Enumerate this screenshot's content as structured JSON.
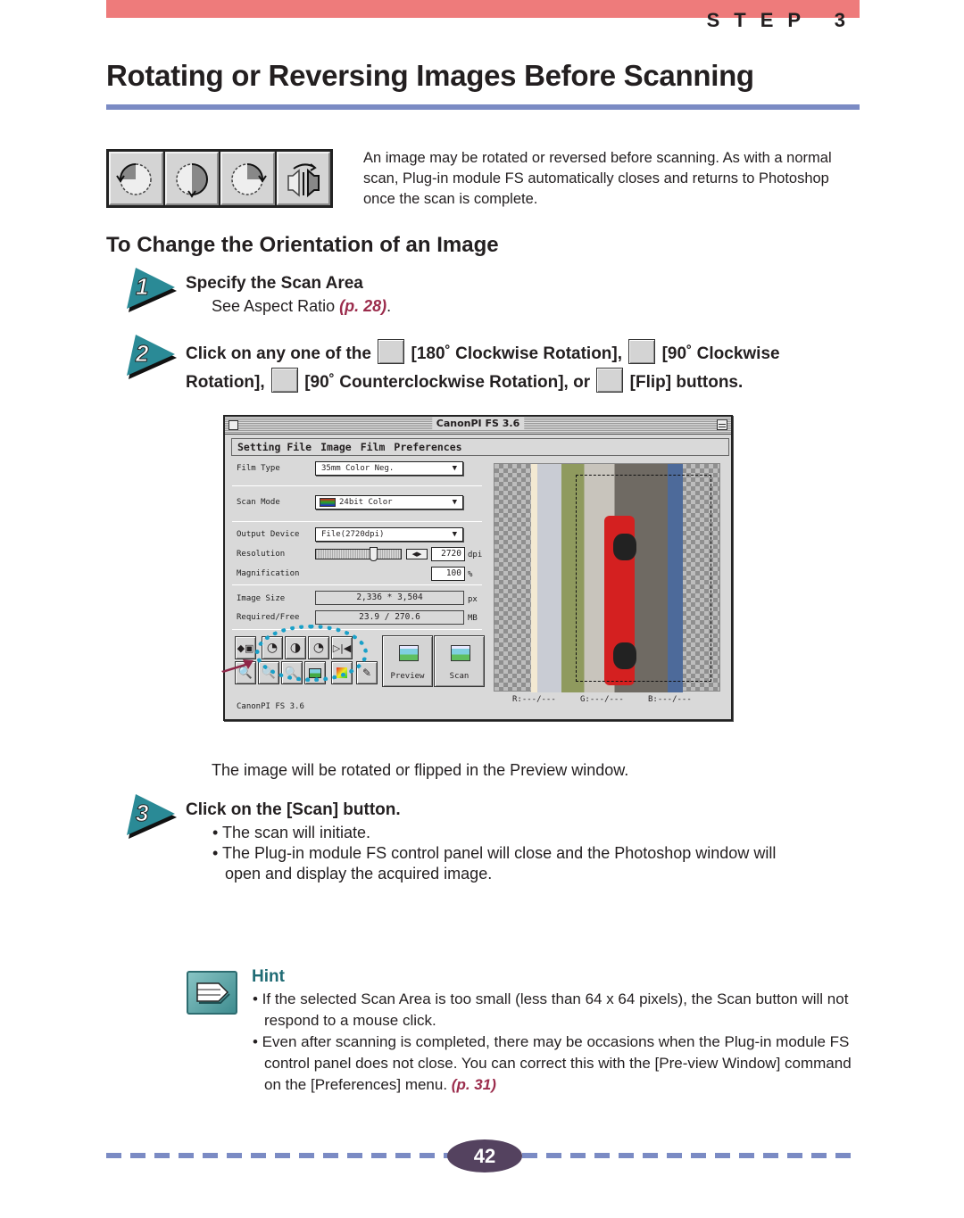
{
  "header": {
    "step_label": "STEP 3",
    "title": "Rotating or Reversing Images Before Scanning"
  },
  "intro": {
    "buttons": [
      {
        "name": "rotate-ccw-90",
        "label": "90° Counterclockwise Rotation"
      },
      {
        "name": "rotate-180",
        "label": "180° Clockwise Rotation"
      },
      {
        "name": "rotate-cw-90",
        "label": "90° Clockwise Rotation"
      },
      {
        "name": "flip",
        "label": "Flip"
      }
    ],
    "text": "An image may be rotated or reversed before scanning. As with a normal scan, Plug-in module FS automatically closes and returns to Photoshop once the scan is complete."
  },
  "section": {
    "title": "To Change the Orientation of an Image"
  },
  "steps": [
    {
      "number": "1",
      "heading": "Specify the Scan Area",
      "body_prefix": "See Aspect Ratio ",
      "link": "(p. 28)",
      "body_suffix": "."
    },
    {
      "number": "2",
      "line1_a": "Click on any one of the ",
      "line1_b": " [180˚ Clockwise Rotation], ",
      "line1_c": " [90˚ Clockwise",
      "line2_a": "Rotation], ",
      "line2_b": " [90˚ Counterclockwise Rotation], or ",
      "line2_c": " [Flip] buttons."
    },
    {
      "number": "3",
      "heading": "Click on the [Scan] button.",
      "bullets": [
        "The scan will initiate.",
        "The Plug-in module FS control panel will close and the Photoshop window will",
        "open and display the acquired image."
      ]
    }
  ],
  "scanner_window": {
    "title": "CanonPI FS 3.6",
    "menu": [
      "Setting File",
      "Image",
      "Film",
      "Preferences"
    ],
    "film_type_label": "Film Type",
    "film_type_value": "35mm Color Neg.",
    "scan_mode_label": "Scan Mode",
    "scan_mode_value": "24bit Color",
    "output_device_label": "Output Device",
    "output_device_value": "File(2720dpi)",
    "resolution_label": "Resolution",
    "resolution_value": "2720",
    "resolution_unit": "dpi",
    "magnification_label": "Magnification",
    "magnification_value": "100",
    "magnification_unit": "%",
    "image_size_label": "Image Size",
    "image_size_value": "2,336 * 3,504",
    "image_size_unit": "px",
    "required_free_label": "Required/Free",
    "required_free_value": "23.9 / 270.6",
    "required_free_unit": "MB",
    "preview_button": "Preview",
    "scan_button": "Scan",
    "version": "CanonPI FS 3.6",
    "rgb": {
      "r": "R:---/---",
      "g": "G:---/---",
      "b": "B:---/---"
    }
  },
  "caption": "The image will be rotated or flipped in the Preview window.",
  "hint": {
    "title": "Hint",
    "items": [
      "• If the selected Scan Area is too small (less than 64 x 64 pixels), the Scan button will not respond to a mouse click.",
      "• Even after scanning is completed, there may be occasions when the Plug-in module FS control panel does not close.  You can correct this with the [Pre-view Window] command on the [Preferences] menu. "
    ],
    "link": "(p. 31)"
  },
  "footer": {
    "page_number": "42"
  },
  "colors": {
    "top_bar": "#ee7b7b",
    "rule": "#7b8bc4",
    "link": "#9b2c4c",
    "hint_title": "#1f6b74",
    "step_arrow": "#2a8a96",
    "callout": "#1aa0c8",
    "page_badge": "#54425f"
  }
}
